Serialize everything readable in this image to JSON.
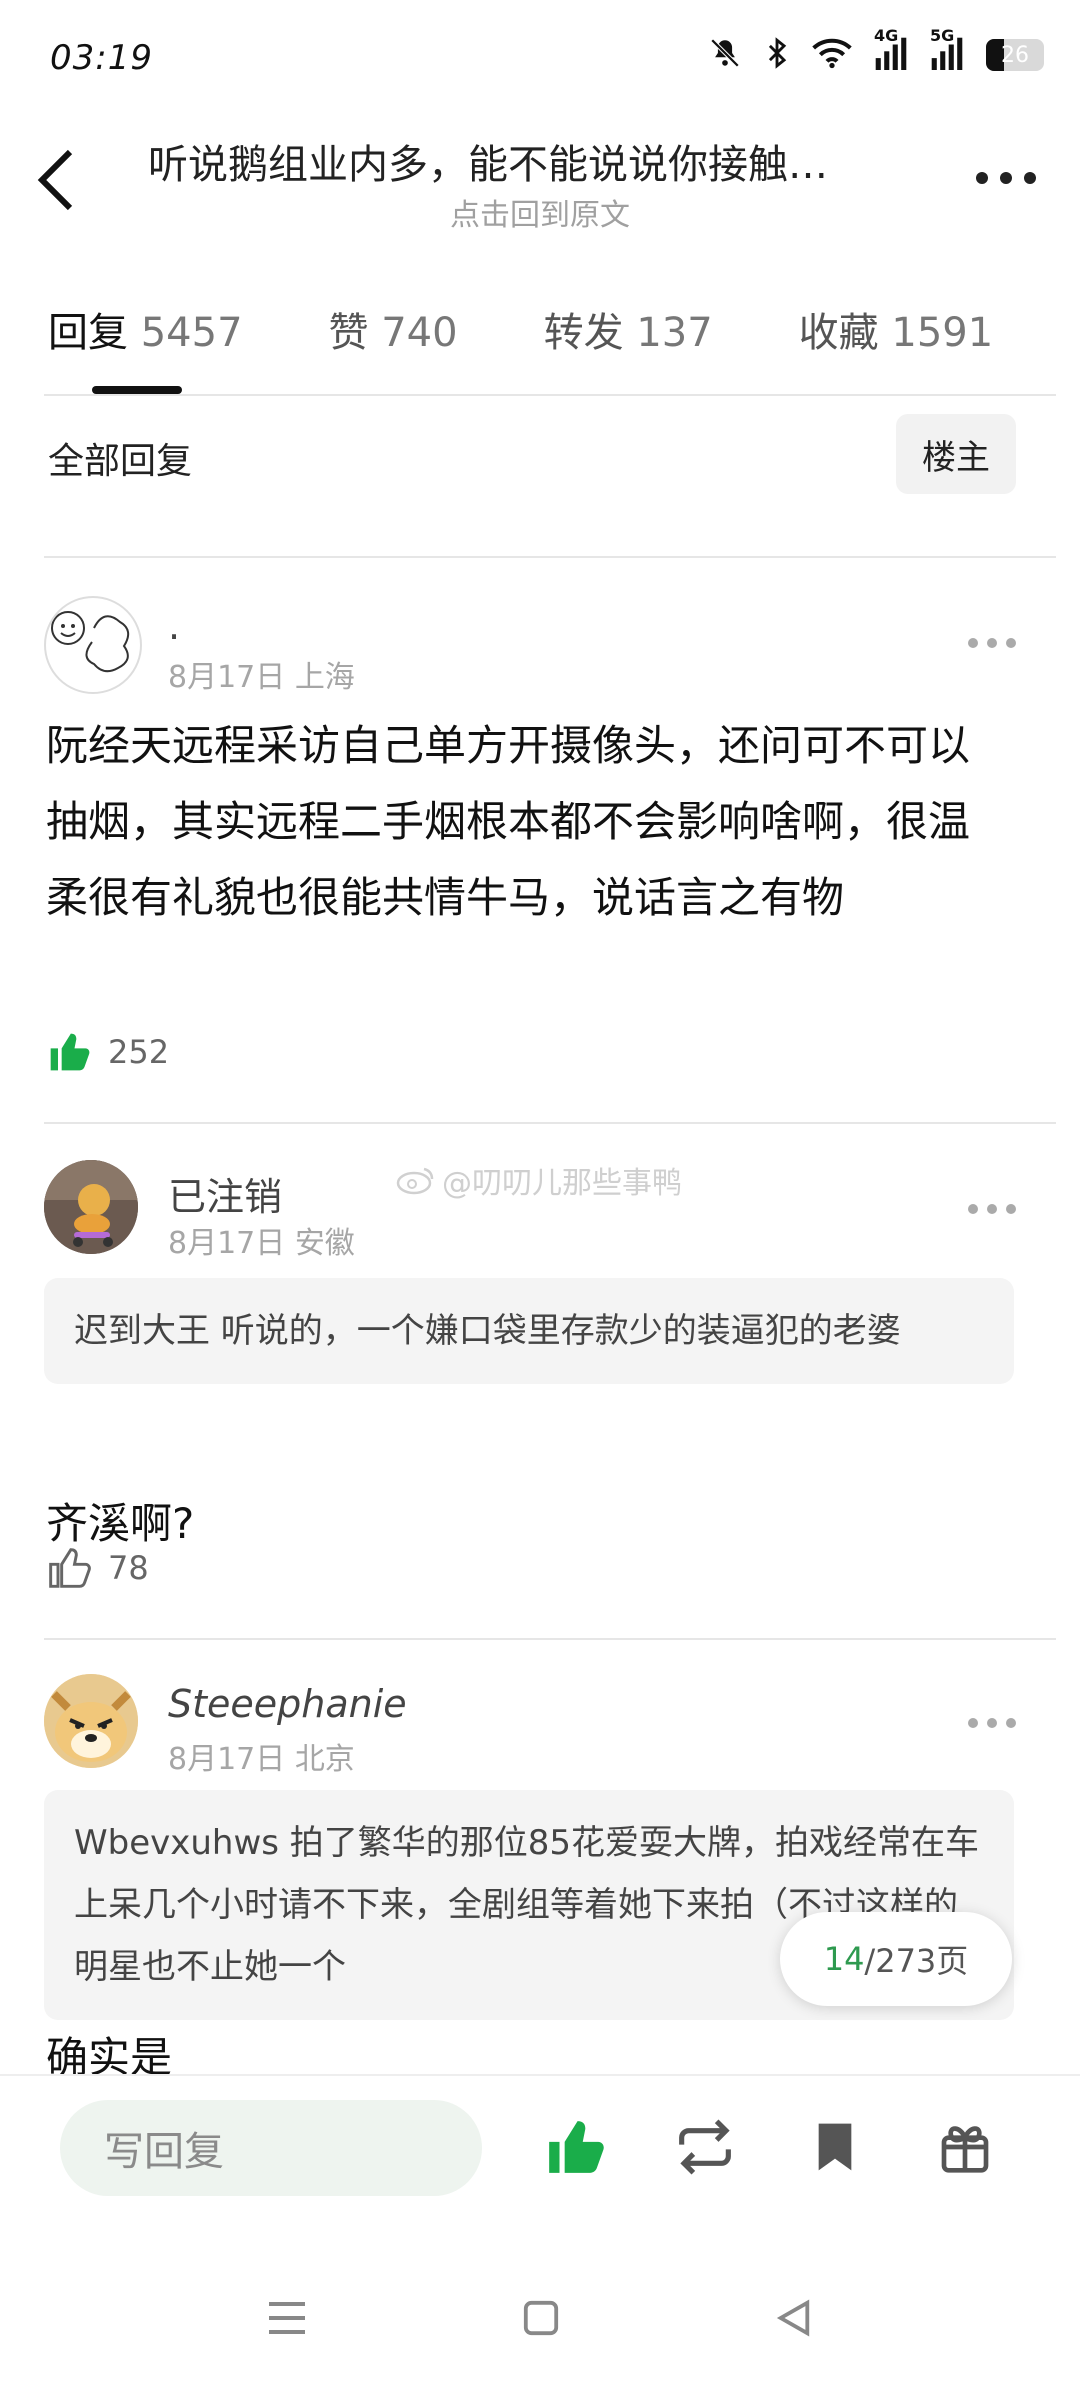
{
  "status_bar": {
    "time": "03:19",
    "network_4g": "4G",
    "network_5g": "5G",
    "battery": "26",
    "icons": [
      "mute-icon",
      "bluetooth-icon",
      "wifi-icon",
      "signal-icon",
      "battery-icon"
    ]
  },
  "header": {
    "title": "听说鹅组业内多，能不能说说你接触…",
    "subtitle": "点击回到原文"
  },
  "tabs": [
    {
      "label": "回复",
      "count": "5457"
    },
    {
      "label": "赞",
      "count": "740"
    },
    {
      "label": "转发",
      "count": "137"
    },
    {
      "label": "收藏",
      "count": "1591"
    }
  ],
  "filter": {
    "all_replies": "全部回复",
    "op_only": "楼主"
  },
  "comments": [
    {
      "username": ".",
      "date": "8月17日",
      "location": "上海",
      "text": "阮经天远程采访自己单方开摄像头，还问可不可以抽烟，其实远程二手烟根本都不会影响啥啊，很温柔很有礼貌也很能共情牛马，说话言之有物",
      "likes": "252"
    },
    {
      "username": "已注销",
      "date": "8月17日",
      "location": "安徽",
      "quote": "迟到大王 听说的，一个嫌口袋里存款少的装逼犯的老婆",
      "text": "齐溪啊?",
      "likes": "78"
    },
    {
      "username": "Steeephanie",
      "date": "8月17日",
      "location": "北京",
      "quote": "Wbevxuhws 拍了繁华的那位85花爱耍大牌，拍戏经常在车上呆几个小时请不下来，全剧组等着她下来拍（不过这样的明星也不止她一个",
      "text": "确实是"
    }
  ],
  "watermark": "@叨叨儿那些事鸭",
  "page_indicator": {
    "current": "14",
    "total": "/273页"
  },
  "bottom_bar": {
    "reply_placeholder": "写回复",
    "icons": [
      "like-icon",
      "repost-icon",
      "bookmark-icon",
      "gift-icon"
    ]
  },
  "colors": {
    "accent_green": "#1aad4a",
    "page_current": "#2e9a4f"
  }
}
